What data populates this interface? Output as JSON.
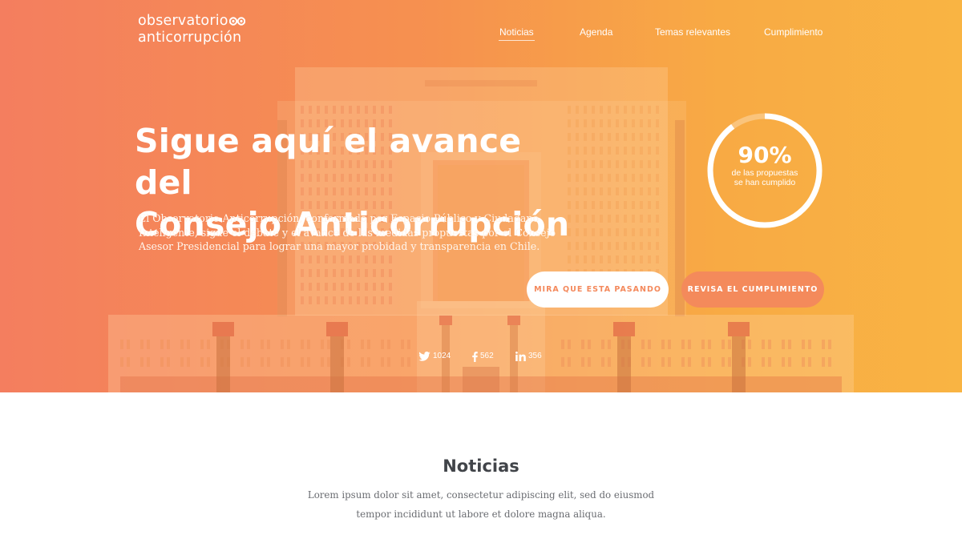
{
  "brand": {
    "line1": "observatorio",
    "line2": "anticorrupción",
    "logo_icon": "binoculars-icon"
  },
  "nav": {
    "items": [
      {
        "label": "Noticias",
        "active": true
      },
      {
        "label": "Agenda",
        "active": false
      },
      {
        "label": "Temas relevantes",
        "active": false
      },
      {
        "label": "Cumplimiento",
        "active": false
      }
    ]
  },
  "hero": {
    "headline_line1": "Sigue aquí el avance del",
    "headline_line2": "Consejo Anticorrupción",
    "description": "El Observatorio Anticorrupción, conformado por Espacio Público y Ciudadano Inteligente, sigue el debate y el avance de las medidas propuestas por el Consejo Asesor Presidencial para lograr una mayor probidad y transparencia en Chile.",
    "progress": {
      "label": "90%",
      "value": 0.9,
      "caption_line1": "de las propuestas",
      "caption_line2": "se han cumplido"
    },
    "primary_button": "MIRA QUE ESTA PASANDO",
    "secondary_button": "REVISA EL CUMPLIMIENTO",
    "colors": {
      "gradient_start": "#f47e5f",
      "gradient_end": "#f9b443",
      "accent": "#f48a5b"
    }
  },
  "social": {
    "twitter": {
      "icon": "twitter-icon",
      "count": "1024"
    },
    "facebook": {
      "icon": "facebook-icon",
      "count": "562"
    },
    "linkedin": {
      "icon": "linkedin-icon",
      "count": "356"
    }
  },
  "news": {
    "title": "Noticias",
    "text": "Lorem ipsum dolor sit amet, consectetur adipiscing elit, sed do eiusmod tempor incididunt ut labore et dolore magna aliqua."
  }
}
